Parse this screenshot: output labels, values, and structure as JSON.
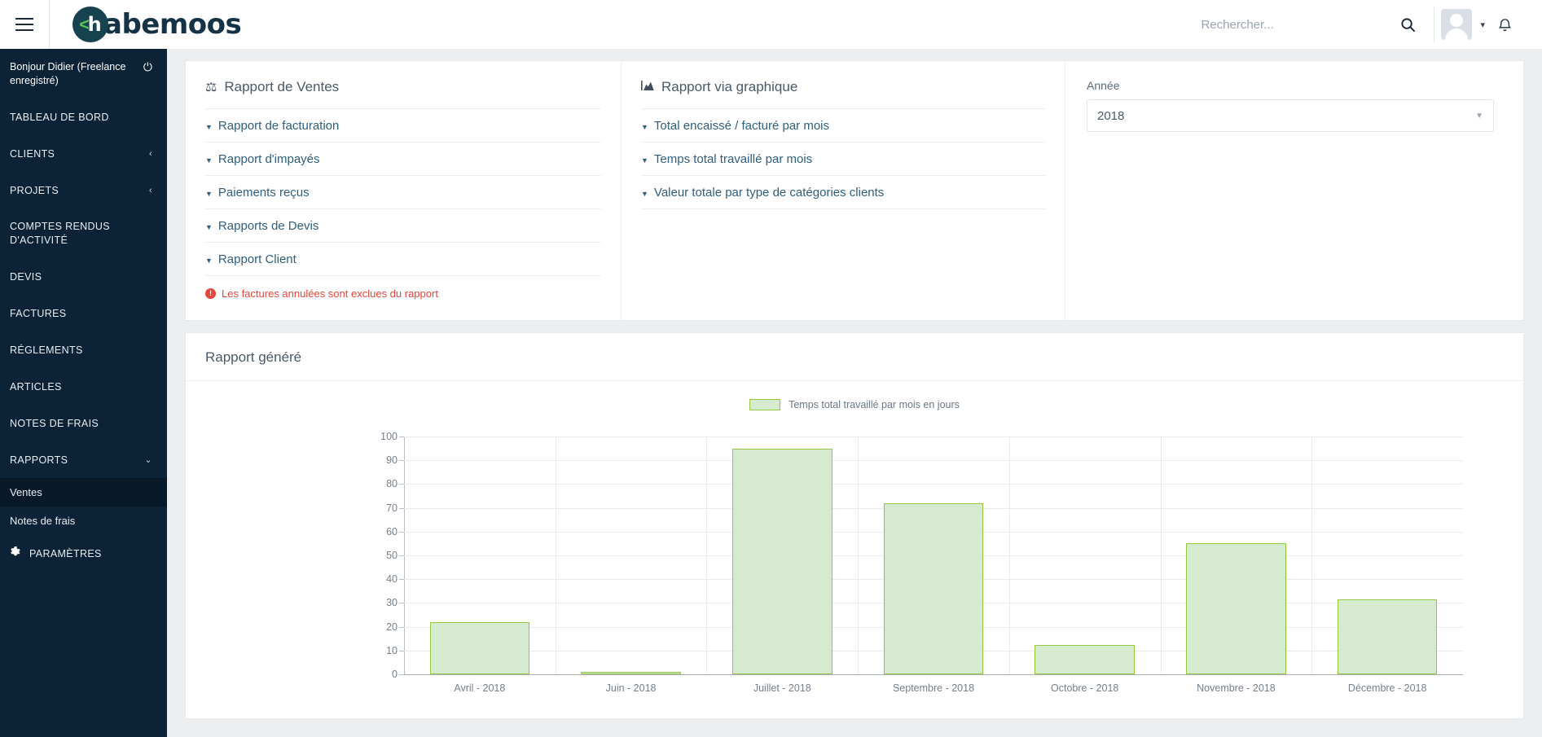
{
  "topbar": {
    "menu_icon": "hamburger-icon",
    "brand": {
      "lt": "<",
      "h": "h",
      "rest": "abemoos"
    },
    "search": {
      "placeholder": "Rechercher...",
      "value": ""
    },
    "search_icon": "search-icon",
    "avatar_icon": "avatar",
    "caret_icon": "chevron-down-icon",
    "bell_icon": "bell-icon"
  },
  "sidebar": {
    "greeting": "Bonjour Didier (Freelance enregistré)",
    "power_icon": "power-icon",
    "items": [
      {
        "label": "TABLEAU DE BORD",
        "chevron": ""
      },
      {
        "label": "CLIENTS",
        "chevron": "‹"
      },
      {
        "label": "PROJETS",
        "chevron": "‹"
      },
      {
        "label": "COMPTES RENDUS D'ACTIVITÉ",
        "chevron": ""
      },
      {
        "label": "DEVIS",
        "chevron": ""
      },
      {
        "label": "FACTURES",
        "chevron": ""
      },
      {
        "label": "RÉGLEMENTS",
        "chevron": ""
      },
      {
        "label": "ARTICLES",
        "chevron": ""
      },
      {
        "label": "NOTES DE FRAIS",
        "chevron": ""
      },
      {
        "label": "RAPPORTS",
        "chevron": "⌄"
      }
    ],
    "subitems": [
      {
        "label": "Ventes",
        "active": true
      },
      {
        "label": "Notes de frais",
        "active": false
      }
    ],
    "settings": {
      "label": "PARAMÈTRES",
      "icon": "gear-icon"
    }
  },
  "sales_panel": {
    "title": "Rapport de Ventes",
    "icon": "balance-scale-icon",
    "links": [
      "Rapport de facturation",
      "Rapport d'impayés",
      "Paiements reçus",
      "Rapports de Devis",
      "Rapport Client"
    ],
    "note": "Les factures annulées sont exclues du rapport",
    "note_icon": "exclamation-circle-icon",
    "note_color": "#e8453c"
  },
  "graph_panel": {
    "title": "Rapport via graphique",
    "icon": "area-chart-icon",
    "links": [
      "Total encaissé / facturé par mois",
      "Temps total travaillé par mois",
      "Valeur totale par type de catégories clients"
    ]
  },
  "year_filter": {
    "label": "Année",
    "value": "2018",
    "caret_icon": "chevron-down-icon",
    "options": [
      "2018"
    ]
  },
  "report": {
    "title": "Rapport généré"
  },
  "chart_data": {
    "type": "bar",
    "title": "",
    "legend": [
      "Temps total travaillé par mois en jours"
    ],
    "legend_position": "top-center",
    "categories": [
      "Avril - 2018",
      "Juin - 2018",
      "Juillet - 2018",
      "Septembre - 2018",
      "Octobre - 2018",
      "Novembre - 2018",
      "Décembre - 2018"
    ],
    "series": [
      {
        "name": "Temps total travaillé par mois en jours",
        "values": [
          22,
          1,
          95,
          72,
          12.5,
          55,
          31.5
        ]
      }
    ],
    "xlabel": "",
    "ylabel": "",
    "ylim": [
      0,
      100
    ],
    "yticks": [
      0,
      10,
      20,
      30,
      40,
      50,
      60,
      70,
      80,
      90,
      100
    ],
    "grid": true,
    "fill_color": "#d6ead0",
    "border_color": "#93c840"
  }
}
